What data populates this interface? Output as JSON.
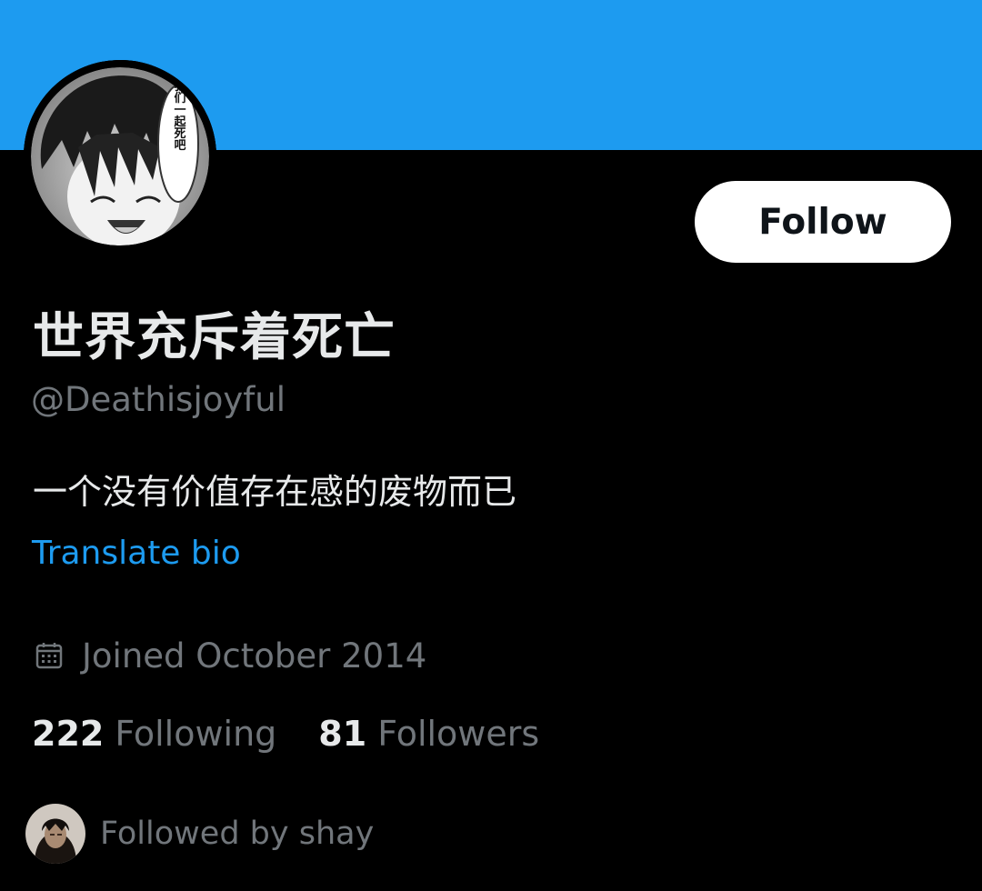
{
  "colors": {
    "banner": "#1d9bf0",
    "background": "#000000",
    "primary_text": "#e7e9ea",
    "secondary_text": "#71767b",
    "link": "#1d9bf0",
    "follow_button_bg": "#ffffff",
    "follow_button_text": "#0f1419"
  },
  "profile": {
    "display_name": "世界充斥着死亡",
    "handle": "@Deathisjoyful",
    "bio": "一个没有价值存在感的废物而已",
    "translate_label": "Translate bio",
    "joined_icon": "calendar-icon",
    "joined": "Joined October 2014",
    "avatar_caption": "让我们一起死吧"
  },
  "actions": {
    "follow_label": "Follow"
  },
  "stats": {
    "following_count": "222",
    "following_label": "Following",
    "followers_count": "81",
    "followers_label": "Followers"
  },
  "followed_by": {
    "text": "Followed by shay"
  }
}
